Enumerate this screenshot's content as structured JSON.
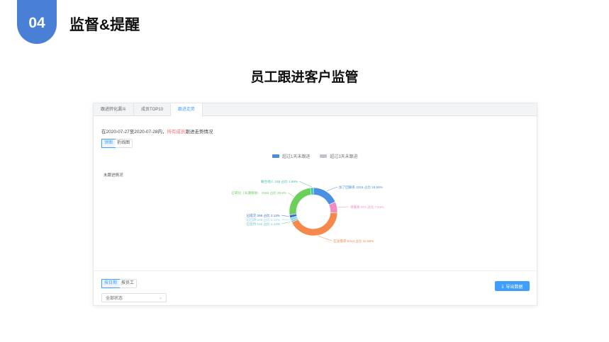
{
  "slide": {
    "badge": "04",
    "section_title": "监督&提醒",
    "title": "员工跟进客户监管"
  },
  "app": {
    "tabs": [
      {
        "label": "跟进转化漏斗",
        "active": false
      },
      {
        "label": "成员TOP10",
        "active": false
      },
      {
        "label": "跟进走势",
        "active": true
      }
    ],
    "info": {
      "prefix": "在2020-07-27至2020-07-28内，",
      "highlight": "所有成员",
      "suffix": "跟进走势情况"
    },
    "chart_switch": [
      {
        "label": "饼图",
        "active": true
      },
      {
        "label": "折线图",
        "active": false
      }
    ],
    "view_switch": [
      {
        "label": "按日期",
        "active": true
      },
      {
        "label": "按员工",
        "active": false
      }
    ],
    "export_label": "导出数据",
    "status_select": "全部状态"
  },
  "chart_data": {
    "type": "pie",
    "donut": true,
    "title": "未跟进情况",
    "legend": [
      {
        "name": "超过1天未跟进",
        "color": "#4a90d9"
      },
      {
        "name": "超过3天未跟进",
        "color": "#c0c4cc"
      }
    ],
    "legend_placement": "top-center",
    "slices": [
      {
        "name": "加了回联系",
        "count": 2319,
        "percent": 18.59,
        "color": "#4a90e2",
        "label": "加了回联系 2319 占比 18.59%"
      },
      {
        "name": "待联系",
        "count": 974,
        "percent": 7.81,
        "color": "#f08cc0",
        "label": "待联系 974 占比 7.81%"
      },
      {
        "name": "在谈需求",
        "count": 5313,
        "percent": 42.58,
        "color": "#f6884b",
        "label": "在谈需求 5313 占比 42.58%"
      },
      {
        "name": "已签约",
        "count": 142,
        "percent": 1.14,
        "color": "#5ec8c4",
        "label": "已签约 142 占比 1.14%"
      },
      {
        "name": "已回款",
        "count": 265,
        "percent": 2.12,
        "color": "#8fd3f0",
        "label": "已回款 265 占比 2.12%"
      },
      {
        "name": "已成交",
        "count": 266,
        "percent": 2.13,
        "color": "#3a6ad4",
        "label": "已成交 266 占比 2.13%"
      },
      {
        "name": "已转化（长期跟进）",
        "count": 3194,
        "percent": 25.6,
        "color": "#6ad05a",
        "label": "已转化（长期跟进） 3194 占比 25.6%"
      },
      {
        "name": "联合他人",
        "count": 248,
        "percent": 1.99,
        "color": "#3fc1a6",
        "label": "联合他人 248 占比 1.99%"
      }
    ]
  }
}
